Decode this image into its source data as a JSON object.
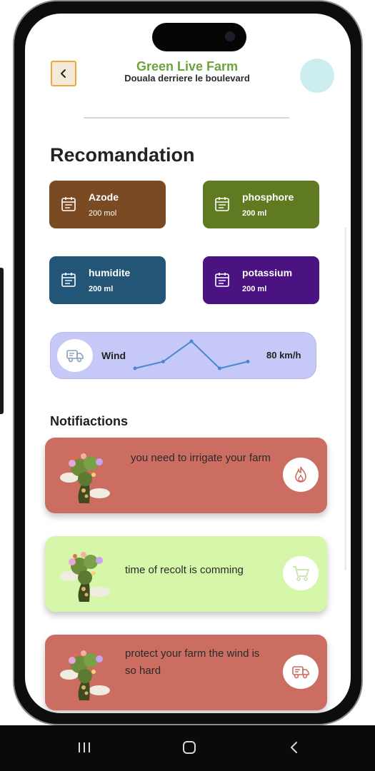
{
  "header": {
    "title": "Green Live Farm",
    "subtitle": "Douala derriere le boulevard"
  },
  "recommendation": {
    "title": "Recomandation",
    "cards": [
      {
        "name": "Azode",
        "value": "200 mol",
        "color": "#7a4a22"
      },
      {
        "name": "phosphore",
        "value": "200 ml",
        "color": "#5f7a21"
      },
      {
        "name": "humidite",
        "value": "200 ml",
        "color": "#235676"
      },
      {
        "name": "potassium",
        "value": "200 ml",
        "color": "#4a1381"
      }
    ]
  },
  "wind": {
    "label": "Wind",
    "value": "80 km/h",
    "line_color": "#4a86d4",
    "trend": [
      2,
      3,
      6,
      2,
      3
    ]
  },
  "notifications": {
    "title": "Notifiactions",
    "items": [
      {
        "text": "you need to irrigate your farm",
        "color": "#cc6d62",
        "icon": "fire-icon"
      },
      {
        "text": "time of recolt is comming",
        "color": "#d6f7a9",
        "icon": "cart-icon"
      },
      {
        "text": "protect your farm the wind is so hard",
        "color": "#cc6d62",
        "icon": "truck-icon"
      }
    ]
  },
  "colors": {
    "accent": "#6ca43a",
    "back_border": "#f0a83c",
    "avatar": "#cdeeee",
    "wind_bg": "#c6c8f7"
  }
}
